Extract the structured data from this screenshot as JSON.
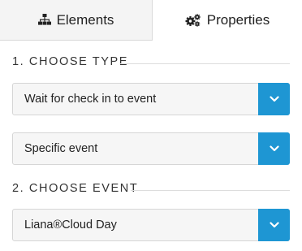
{
  "tabs": {
    "elements": {
      "label": "Elements",
      "icon": "sitemap-icon"
    },
    "properties": {
      "label": "Properties",
      "icon": "cogs-icon",
      "active": true
    }
  },
  "section1": {
    "title": "1. CHOOSE TYPE",
    "select_type": {
      "value": "Wait for check in to event"
    },
    "select_scope": {
      "value": "Specific event"
    }
  },
  "section2": {
    "title": "2. CHOOSE EVENT",
    "select_event": {
      "value": "Liana®Cloud Day"
    }
  },
  "colors": {
    "accent": "#1e96d3",
    "inactive_tab_bg": "#f4f4f4",
    "field_bg": "#f6f6f6"
  }
}
